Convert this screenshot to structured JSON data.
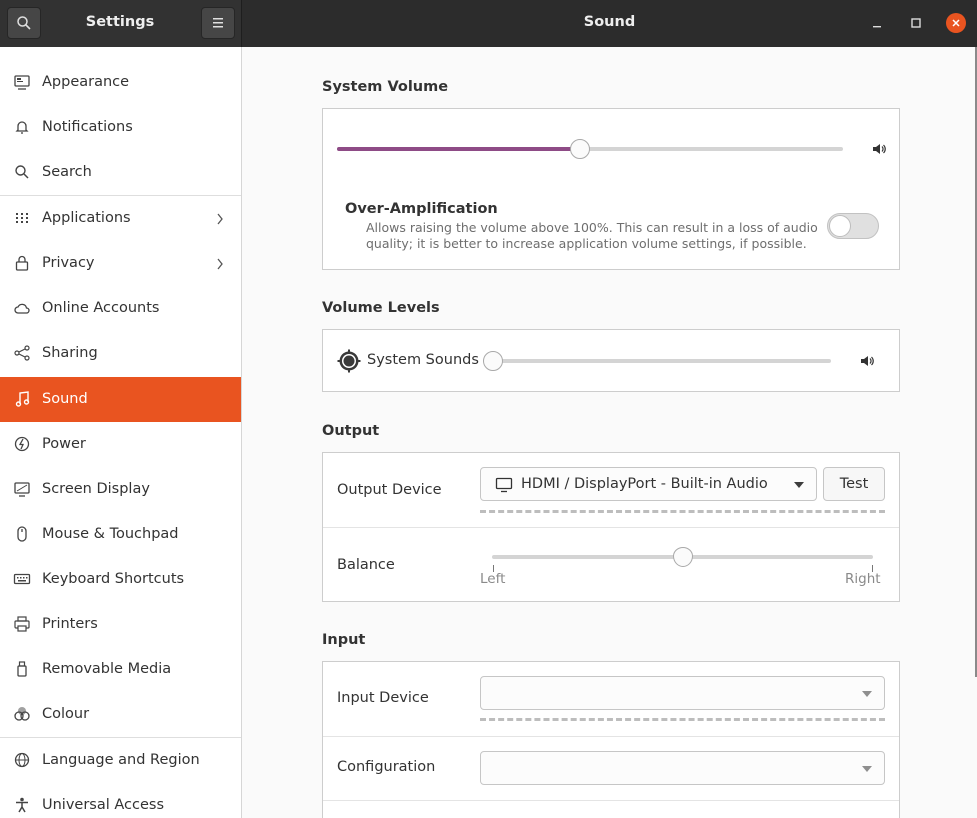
{
  "header": {
    "app_title": "Settings",
    "page_title": "Sound"
  },
  "sidebar": {
    "active_item": "Sound",
    "items": [
      {
        "label": "Appearance",
        "icon": "appearance-icon"
      },
      {
        "label": "Notifications",
        "icon": "bell-icon"
      },
      {
        "label": "Search",
        "icon": "search-icon"
      },
      {
        "label": "Applications",
        "icon": "grid-icon",
        "has_submenu": true
      },
      {
        "label": "Privacy",
        "icon": "lock-icon",
        "has_submenu": true
      },
      {
        "label": "Online Accounts",
        "icon": "cloud-icon"
      },
      {
        "label": "Sharing",
        "icon": "share-icon"
      },
      {
        "label": "Sound",
        "icon": "music-note-icon"
      },
      {
        "label": "Power",
        "icon": "power-icon"
      },
      {
        "label": "Screen Display",
        "icon": "display-icon"
      },
      {
        "label": "Mouse & Touchpad",
        "icon": "mouse-icon"
      },
      {
        "label": "Keyboard Shortcuts",
        "icon": "keyboard-icon"
      },
      {
        "label": "Printers",
        "icon": "printer-icon"
      },
      {
        "label": "Removable Media",
        "icon": "usb-icon"
      },
      {
        "label": "Colour",
        "icon": "colour-icon"
      },
      {
        "label": "Language and Region",
        "icon": "globe-icon"
      },
      {
        "label": "Universal Access",
        "icon": "accessibility-icon"
      }
    ]
  },
  "system_volume": {
    "title": "System Volume",
    "level": 0.48,
    "over_amplification": {
      "title": "Over-Amplification",
      "description_line1": "Allows raising the volume above 100%. This can result in a loss of audio",
      "description_line2": "quality; it is better to increase application volume settings, if possible.",
      "enabled": false
    }
  },
  "volume_levels": {
    "title": "Volume Levels",
    "system_sounds": {
      "label": "System Sounds",
      "level": 0.0
    }
  },
  "output": {
    "title": "Output",
    "device_label": "Output Device",
    "device_value": "HDMI / DisplayPort - Built-in Audio",
    "test_label": "Test",
    "balance_label": "Balance",
    "balance_value": 0.5,
    "balance_left": "Left",
    "balance_right": "Right"
  },
  "input": {
    "title": "Input",
    "device_label": "Input Device",
    "device_value": "",
    "configuration_label": "Configuration",
    "configuration_value": ""
  },
  "colors": {
    "accent": "#e95420",
    "slider_fill": "#8e4b86",
    "headerbar": "#2c2c2c"
  }
}
